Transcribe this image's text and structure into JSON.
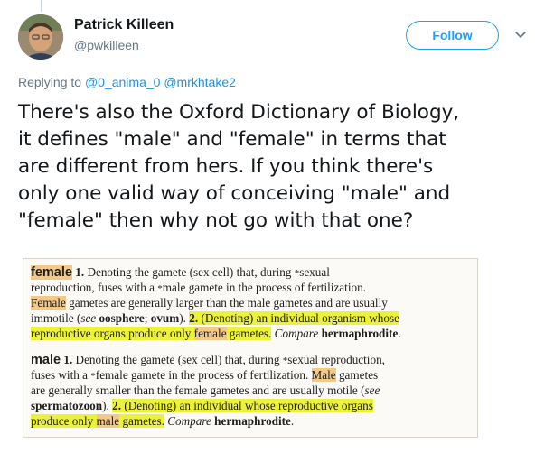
{
  "tweet": {
    "author_name": "Patrick Killeen",
    "author_handle": "@pwkilleen",
    "follow_label": "Follow",
    "reply_prefix": "Replying to",
    "reply_mentions": [
      "@0_anima_0",
      "@mrkhtake2"
    ],
    "text_lines": [
      "There's also the Oxford Dictionary of Biology,",
      "it defines \"male\" and \"female\" in terms that",
      "are different from hers. If you think there's",
      "only one valid way of conceiving \"male\" and",
      "\"female\" then why not go with that one?"
    ]
  },
  "dictionary": {
    "female": {
      "headword": "female",
      "sense1_num": "1.",
      "l1": " Denoting the gamete (sex cell) that, during ",
      "l1_star": "*",
      "l1_b": "sexual",
      "l2a": "reproduction, fuses with a ",
      "l2_star": "*",
      "l2b": "male gamete in the process of fertilization.",
      "l3_hl": "Female",
      "l3_rest": " gametes are generally larger than the male gametes and are usually",
      "l4a": "immotile (",
      "l4_see": "see",
      "l4_b1": "oosphere",
      "l4_sep": "; ",
      "l4_b2": "ovum",
      "l4_c": "). ",
      "l4_hl_num": "2.",
      "l4_hl_text": " (Denoting) an individual organism whose",
      "l5_hl": "reproductive organs produce only ",
      "l5_hl2": "female",
      "l5_hl3": " gametes.",
      "l5_compare": " Compare ",
      "l5_b": "hermaphrodite",
      "l5_end": "."
    },
    "male": {
      "headword": "male",
      "sense1_num": "1.",
      "l1": " Denoting the gamete (sex cell) that, during ",
      "l1_star": "*",
      "l1_b": "sexual reproduction,",
      "l2a": "fuses with a ",
      "l2_star": "*",
      "l2b": "female gamete in the process of fertilization. ",
      "l2_hl": "Male",
      "l2_end": " gametes",
      "l3": "are generally smaller than the female gametes and are usually motile (",
      "l3_see": "see",
      "l4_b": "spermatozoon",
      "l4_c": "). ",
      "l4_hl_num": "2.",
      "l4_hl_text": " (Denoting) an individual whose reproductive organs",
      "l5_hl": "produce only ",
      "l5_hl2": "male",
      "l5_hl3": " gametes.",
      "l5_compare": " Compare ",
      "l5_b": "hermaphrodite",
      "l5_end": "."
    }
  },
  "colors": {
    "follow_blue": "#1da1f2",
    "mention_blue": "#1b95e0",
    "highlight_yellow": "#ecf23a",
    "highlight_orange": "#f3c98a"
  },
  "icons": {
    "dropdown": "chevron-down-icon",
    "avatar": "user-photo"
  }
}
